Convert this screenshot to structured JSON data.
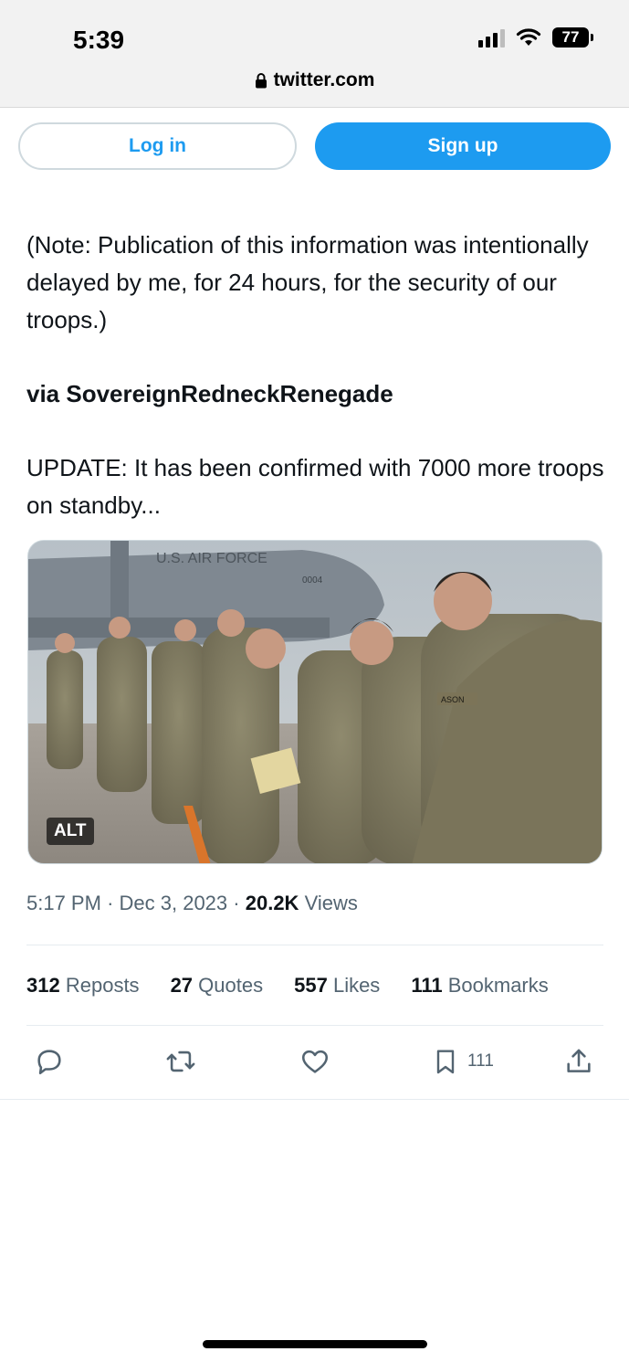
{
  "status_bar": {
    "time": "5:39",
    "battery": "77"
  },
  "browser": {
    "url": "twitter.com"
  },
  "auth": {
    "login_label": "Log in",
    "signup_label": "Sign up"
  },
  "tweet": {
    "paragraph1": "(Note: Publication of this information was intentionally delayed by me, for 24 hours, for the security of our troops.)",
    "paragraph2": "via SovereignRedneckRenegade",
    "paragraph3": "UPDATE: It has been confirmed with 7000 more troops on standby...",
    "media_alt_badge": "ALT",
    "image_text": {
      "aircraft_label": "U.S. AIR FORCE",
      "tail_number": "0004",
      "name_tape": "ASON"
    }
  },
  "meta": {
    "time": "5:17 PM",
    "separator": "·",
    "date": "Dec 3, 2023",
    "views_count": "20.2K",
    "views_label": "Views"
  },
  "stats": [
    {
      "count": "312",
      "label": "Reposts"
    },
    {
      "count": "27",
      "label": "Quotes"
    },
    {
      "count": "557",
      "label": "Likes"
    },
    {
      "count": "111",
      "label": "Bookmarks"
    }
  ],
  "actions": {
    "reply": {
      "icon": "reply-icon"
    },
    "repost": {
      "icon": "repost-icon"
    },
    "like": {
      "icon": "heart-icon"
    },
    "bookmark": {
      "icon": "bookmark-icon",
      "count": "111"
    },
    "share": {
      "icon": "share-icon"
    }
  },
  "colors": {
    "accent": "#1d9bf0",
    "text": "#0f1419",
    "secondary": "#536471"
  }
}
